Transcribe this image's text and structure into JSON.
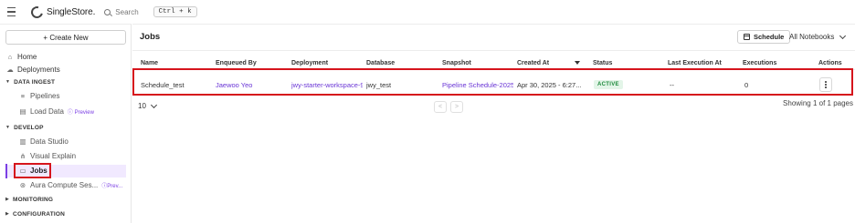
{
  "topbar": {
    "brand": "SingleStore",
    "brand_suffix": ".",
    "search_placeholder": "Search",
    "shortcut": "Ctrl + k"
  },
  "sidebar": {
    "create_label": "+ Create New",
    "home": "Home",
    "deployments": "Deployments",
    "data_ingest": "DATA INGEST",
    "pipelines": "Pipelines",
    "load_data": "Load Data",
    "load_data_badge": "Preview",
    "develop": "DEVELOP",
    "data_studio": "Data Studio",
    "visual_explain": "Visual Explain",
    "jobs": "Jobs",
    "aura": "Aura Compute Ses...",
    "aura_badge": "Prev...",
    "monitoring": "MONITORING",
    "configuration": "CONFIGURATION"
  },
  "main": {
    "title": "Jobs",
    "schedule_label": "Schedule",
    "notebook_filter": "All Notebooks",
    "columns": [
      "Name",
      "Enqueued By",
      "Deployment",
      "Database",
      "Snapshot",
      "Created At",
      "Status",
      "Last Execution At",
      "Executions",
      "Actions"
    ],
    "rows": [
      {
        "name": "Schedule_test",
        "enqueued_by": "Jaewoo Yeo",
        "deployment": "jwy-starter-workspace-9",
        "database": "jwy_test",
        "snapshot": "Pipeline Schedule-2025",
        "created_at": "Apr 30, 2025 - 6:27...",
        "status": "ACTIVE",
        "last_execution": "--",
        "executions": "0"
      }
    ],
    "page_size": "10",
    "showing": "Showing 1 of 1 pages"
  },
  "colors": {
    "accent": "#7b3fe4",
    "highlight": "#d6141c",
    "active_badge_bg": "#e3f5e8",
    "active_badge_text": "#1e8a3c"
  }
}
